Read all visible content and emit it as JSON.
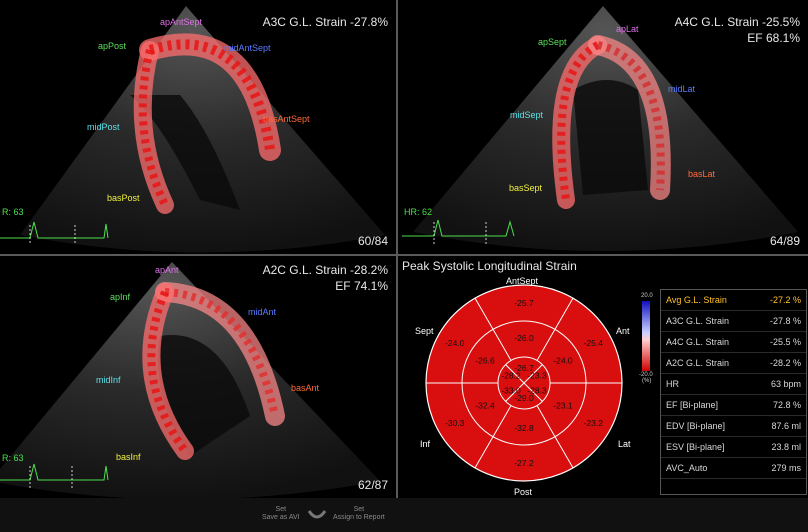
{
  "views": {
    "a3c": {
      "title": "A3C G.L. Strain -27.8%",
      "frame": "60/84",
      "hr": "R: 63",
      "segments": {
        "ap_ant_sept": "apAntSept",
        "ap_post": "apPost",
        "mid_ant_sept": "midAntSept",
        "mid_post": "midPost",
        "bas_ant_sept": "basAntSept",
        "bas_post": "basPost"
      }
    },
    "a4c": {
      "title": "A4C G.L. Strain -25.5%",
      "ef": "EF 68.1%",
      "frame": "64/89",
      "hr": "HR: 62",
      "segments": {
        "ap_lat": "apLat",
        "ap_sept": "apSept",
        "mid_lat": "midLat",
        "mid_sept": "midSept",
        "bas_lat": "basLat",
        "bas_sept": "basSept"
      }
    },
    "a2c": {
      "title": "A2C G.L. Strain -28.2%",
      "ef": "EF 74.1%",
      "frame": "62/87",
      "hr": "R: 63",
      "segments": {
        "ap_ant": "apAnt",
        "ap_inf": "apInf",
        "mid_ant": "midAnt",
        "mid_inf": "midInf",
        "bas_ant": "basAnt",
        "bas_inf": "basInf"
      }
    }
  },
  "bullseye": {
    "title": "Peak Systolic Longitudinal Strain",
    "labels": {
      "top": "AntSept",
      "left_top": "Sept",
      "right_top": "Ant",
      "left_bottom": "Inf",
      "right_bottom": "Lat",
      "bottom": "Post"
    },
    "fill_color": "#d90e0e",
    "outer": [
      "-25.7",
      "-25.4",
      "-23.2",
      "-27.2",
      "-30.3",
      "-24.0"
    ],
    "mid": [
      "-26.0",
      "-24.0",
      "-23.1",
      "-32.8",
      "-32.4",
      "-26.6"
    ],
    "apical": [
      "-26.7",
      "-23.3",
      "-28.3",
      "-29.0",
      "-33.0",
      "-28.2"
    ],
    "scale": {
      "top": "20.0",
      "bottom": "-20.0",
      "unit": "(%)"
    }
  },
  "stats": [
    {
      "label": "Avg G.L. Strain",
      "value": "-27.2 %",
      "highlight": true
    },
    {
      "label": "A3C G.L. Strain",
      "value": "-27.8 %"
    },
    {
      "label": "A4C G.L. Strain",
      "value": "-25.5 %"
    },
    {
      "label": "A2C G.L. Strain",
      "value": "-28.2 %"
    },
    {
      "label": "HR",
      "value": "63 bpm"
    },
    {
      "label": "EF [Bi-plane]",
      "value": "72.8 %"
    },
    {
      "label": "EDV [Bi-plane]",
      "value": "87.6 ml"
    },
    {
      "label": "ESV [Bi-plane]",
      "value": "23.8 ml"
    },
    {
      "label": "AVC_Auto",
      "value": "279 ms"
    }
  ],
  "bottom_bar": {
    "left_line1": "Set",
    "left_line2": "Save as AVI",
    "right_line1": "Set",
    "right_line2": "Assign to Report"
  },
  "colors": {
    "accent": "#ffc22a",
    "hr_trace": "#4ce04c",
    "strain_red": "#d90e0e",
    "divider": "#5a5a5a"
  }
}
